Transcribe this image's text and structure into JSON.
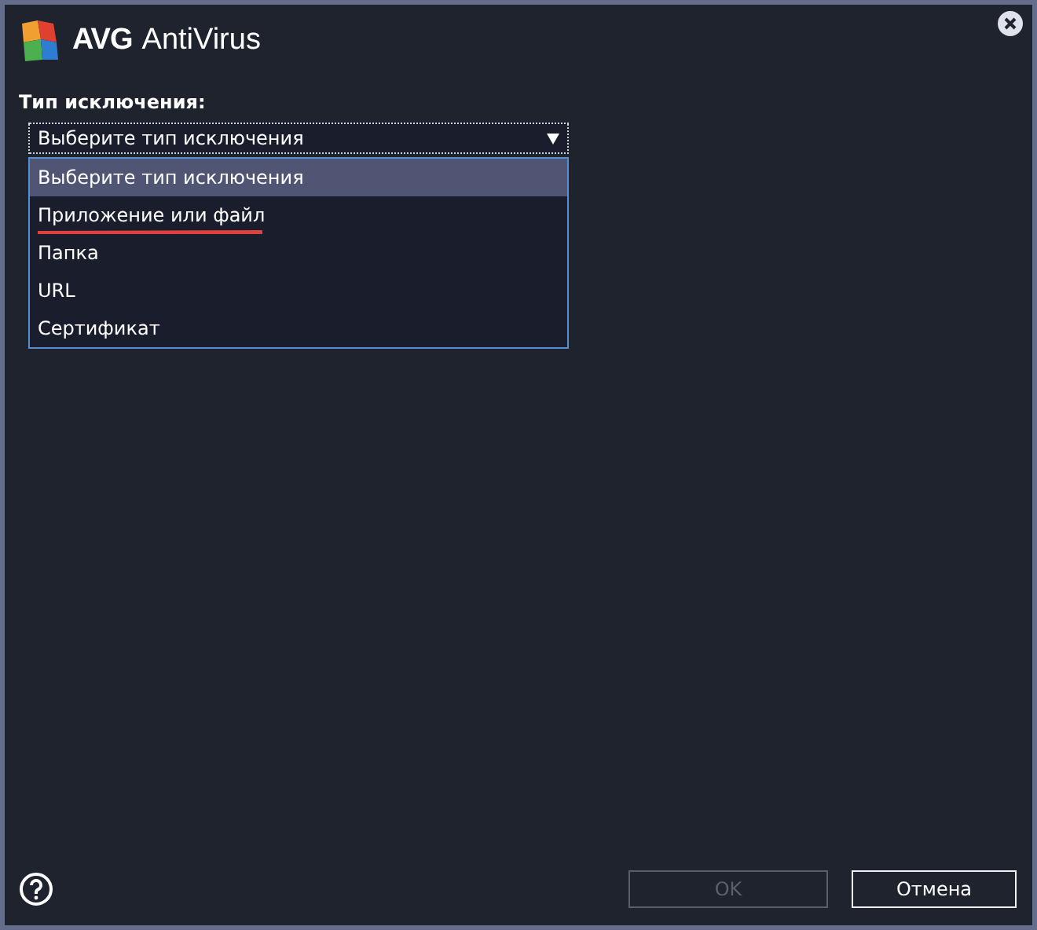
{
  "window": {
    "brand": "AVG",
    "product": "AntiVirus"
  },
  "exclusion_type": {
    "label": "Тип исключения:",
    "value": "Выберите тип исключения",
    "expanded": true,
    "options": [
      {
        "label": "Выберите тип исключения",
        "selected": true,
        "underlined": false
      },
      {
        "label": "Приложение или файл",
        "selected": false,
        "underlined": true
      },
      {
        "label": "Папка",
        "selected": false,
        "underlined": false
      },
      {
        "label": "URL",
        "selected": false,
        "underlined": false
      },
      {
        "label": "Сертификат",
        "selected": false,
        "underlined": false
      }
    ]
  },
  "buttons": [
    {
      "label": "OK",
      "disabled": true
    },
    {
      "label": "Отмена",
      "disabled": false
    }
  ]
}
